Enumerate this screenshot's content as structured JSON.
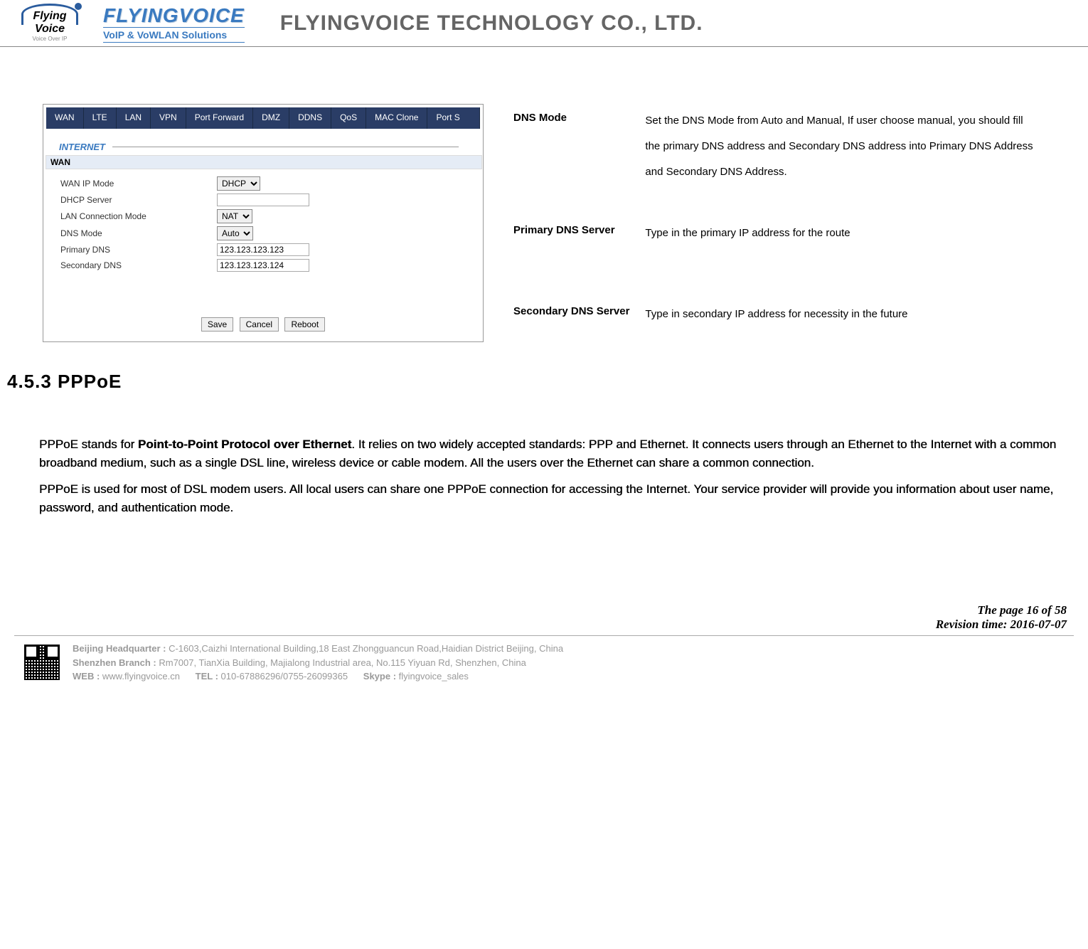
{
  "header": {
    "logo_flying": "Flying",
    "logo_voice": "Voice",
    "logo_sub": "Voice Over IP",
    "brand_title": "FLYINGVOICE",
    "brand_sub": "VoIP & VoWLAN Solutions",
    "company": "FLYINGVOICE TECHNOLOGY CO., LTD."
  },
  "tabs": [
    "WAN",
    "LTE",
    "LAN",
    "VPN",
    "Port Forward",
    "DMZ",
    "DDNS",
    "QoS",
    "MAC Clone",
    "Port S"
  ],
  "internet_label": "INTERNET",
  "wan_label": "WAN",
  "form": {
    "wan_ip_mode": {
      "label": "WAN IP Mode",
      "value": "DHCP"
    },
    "dhcp_server": {
      "label": "DHCP Server",
      "value": ""
    },
    "lan_conn_mode": {
      "label": "LAN Connection Mode",
      "value": "NAT"
    },
    "dns_mode": {
      "label": "DNS Mode",
      "value": "Auto"
    },
    "primary_dns": {
      "label": "Primary DNS",
      "value": "123.123.123.123"
    },
    "secondary_dns": {
      "label": "Secondary DNS",
      "value": "123.123.123.124"
    }
  },
  "buttons": {
    "save": "Save",
    "cancel": "Cancel",
    "reboot": "Reboot"
  },
  "desc": [
    {
      "name": "DNS Mode",
      "text": "Set the DNS Mode from Auto and Manual, If user choose manual, you should fill the primary DNS address and Secondary DNS address into Primary DNS Address and Secondary DNS Address."
    },
    {
      "name": "Primary DNS Server",
      "text": "Type in the primary IP address for the route"
    },
    {
      "name": "Secondary DNS Server",
      "text": "Type in secondary IP address for necessity in the future"
    }
  ],
  "section_heading": "4.5.3 PPPoE",
  "para1_pre": "PPPoE stands for ",
  "para1_bold": "Point-to-Point Protocol over Ethernet",
  "para1_post": ". It relies on two widely accepted standards: PPP and Ethernet. It connects users through an Ethernet to the Internet with a common broadband medium, such as a single DSL line, wireless device or cable modem. All the users over the Ethernet can share a common connection.",
  "para2": "PPPoE is used for most of DSL modem users. All local users can share one PPPoE connection for accessing the Internet. Your service provider will provide you information about user name, password, and authentication mode.",
  "footer_page": "The page 16 of 58",
  "footer_rev": "Revision time: 2016-07-07",
  "footer_lines": {
    "hq_label": "Beijing Headquarter  : ",
    "hq": "C-1603,Caizhi International Building,18 East Zhongguancun Road,Haidian District Beijing, China",
    "sz_label": "Shenzhen Branch : ",
    "sz": "Rm7007, TianXia Building, Majialong Industrial area, No.115 Yiyuan Rd, Shenzhen, China",
    "web_label": "WEB : ",
    "web": "www.flyingvoice.cn",
    "tel_label": "TEL : ",
    "tel": "010-67886296/0755-26099365",
    "skype_label": "Skype : ",
    "skype": "flyingvoice_sales"
  }
}
